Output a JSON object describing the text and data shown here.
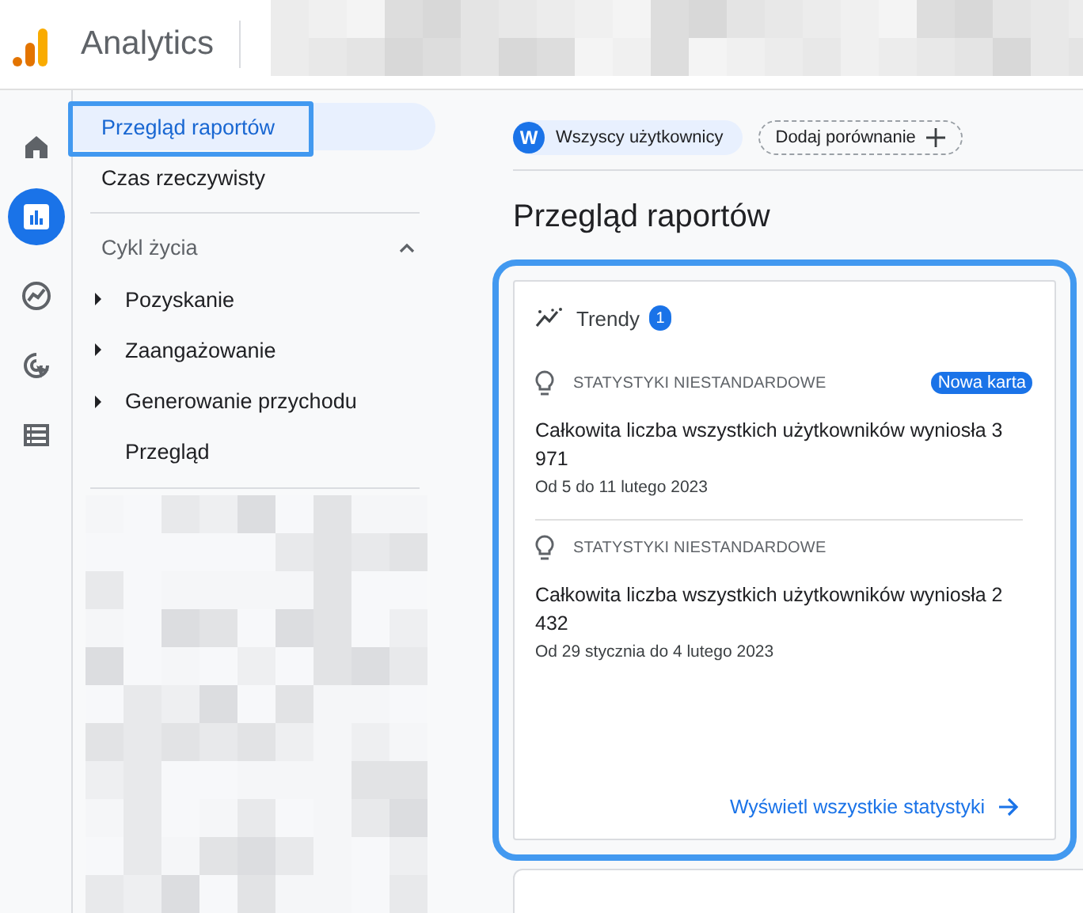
{
  "header": {
    "product": "Analytics"
  },
  "rail": [
    {
      "kind": "home",
      "selected": false
    },
    {
      "kind": "reports",
      "selected": true
    },
    {
      "kind": "explore",
      "selected": false
    },
    {
      "kind": "advertising",
      "selected": false
    },
    {
      "kind": "configure",
      "selected": false
    }
  ],
  "nav": {
    "items": [
      {
        "kind": "link",
        "label": "Przegląd raportów",
        "selected": true,
        "highlighted": true
      },
      {
        "kind": "link",
        "label": "Czas rzeczywisty",
        "selected": false,
        "highlighted": false
      },
      {
        "kind": "section",
        "label": "Cykl życia",
        "expanded": true,
        "children": [
          {
            "kind": "group",
            "label": "Pozyskanie",
            "expanded": false
          },
          {
            "kind": "group",
            "label": "Zaangażowanie",
            "expanded": false
          },
          {
            "kind": "group",
            "label": "Generowanie przychodu",
            "expanded": false
          },
          {
            "kind": "link",
            "label": "Przegląd",
            "selected": false,
            "highlighted": false
          }
        ]
      }
    ]
  },
  "comparison": {
    "segments": [
      {
        "avatar": "W",
        "label": "Wszyscy użytkownicy"
      }
    ],
    "add_button": "Dodaj porównanie"
  },
  "page_title": "Przegląd raportów",
  "insights_card": {
    "highlighted": true,
    "title": "Trendy",
    "count": "1",
    "insights": [
      {
        "category": "STATYSTYKI NIESTANDARDOWE",
        "badge": "Nowa karta",
        "text": "Całkowita liczba wszystkich użytkowników wyniosła 3 971",
        "date": "Od 5 do 11 lutego 2023"
      },
      {
        "category": "STATYSTYKI NIESTANDARDOWE",
        "text": "Całkowita liczba wszystkich użytkowników wyniosła 2 432",
        "date": "Od 29 stycznia do 4 lutego 2023"
      }
    ],
    "link": "Wyświetl wszystkie statystyki"
  }
}
